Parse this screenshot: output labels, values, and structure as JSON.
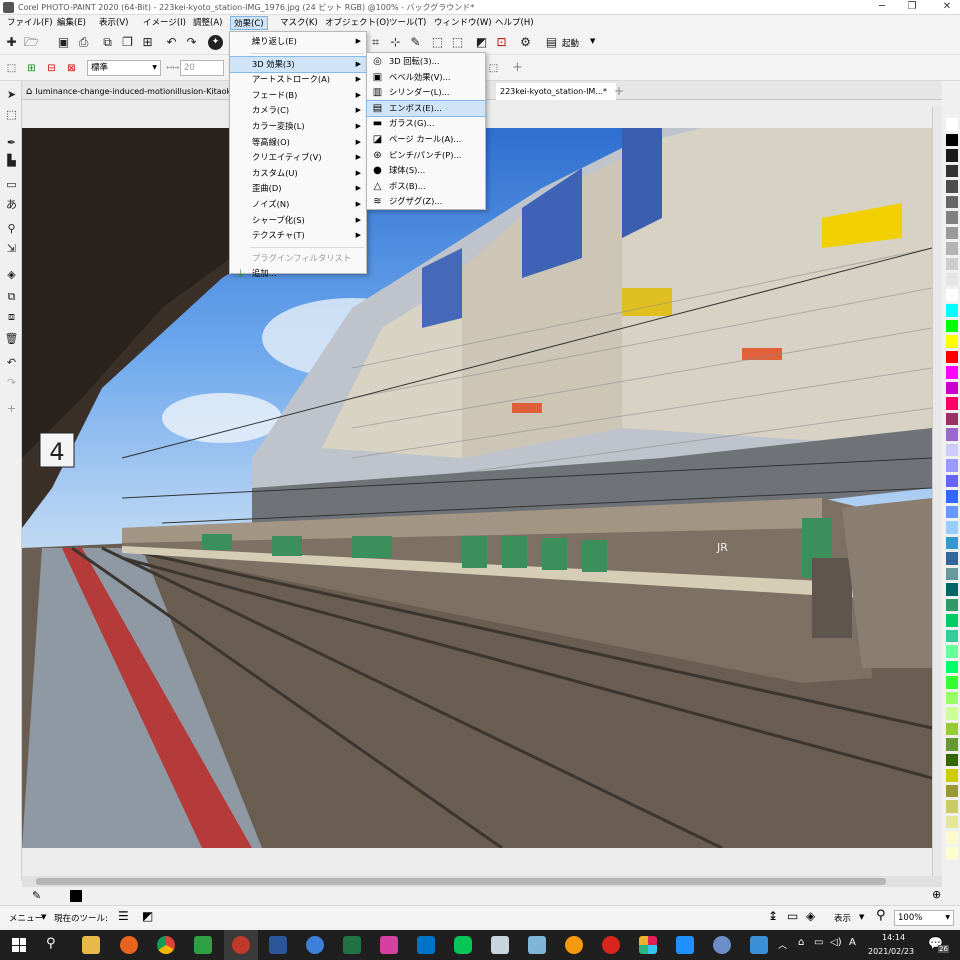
{
  "window": {
    "title": "Corel PHOTO-PAINT 2020 (64-Bit) - 223kei-kyoto_station-IMG_1976.jpg (24 ビット RGB) @100% - バックグラウンド*",
    "minimize": "─",
    "restore": "❐",
    "close": "✕"
  },
  "menubar": [
    "ファイル(F)",
    "編集(E)",
    "表示(V)",
    "イメージ(I)",
    "調整(A)",
    "効果(C)",
    "マスク(K)",
    "オブジェクト(O)",
    "ツール(T)",
    "ウィンドウ(W)",
    "ヘルプ(H)"
  ],
  "toolbar": {
    "launch_label": "起動",
    "mode_value": "標準",
    "size_value": "20"
  },
  "tabs": [
    "luminance-change-induced-motionillusion-Kitaoka200",
    "223kei-kyoto_station-IM...*"
  ],
  "effects_menu": {
    "items": [
      "繰り返し(E)",
      "3D 効果(3)",
      "アートストローク(A)",
      "フェード(B)",
      "カメラ(C)",
      "カラー変換(L)",
      "等高線(O)",
      "クリエイティブ(V)",
      "カスタム(U)",
      "歪曲(D)",
      "ノイズ(N)",
      "シャープ化(S)",
      "テクスチャ(T)"
    ],
    "plugin_list": "プラグインフィルタリスト",
    "add": "追加..."
  },
  "submenu_3d": {
    "items": [
      "3D 回転(3)...",
      "ベベル効果(V)...",
      "シリンダー(L)...",
      "エンボス(E)...",
      "ガラス(G)...",
      "ページ カール(A)...",
      "ピンチ/パンチ(P)...",
      "球体(S)...",
      "ボス(B)...",
      "ジグザグ(Z)..."
    ],
    "icons": [
      "rotate-3d-icon",
      "bevel-icon",
      "cylinder-icon",
      "emboss-icon",
      "glass-icon",
      "page-curl-icon",
      "pinch-punch-icon",
      "sphere-icon",
      "boss-icon",
      "zigzag-icon"
    ],
    "highlighted": "エンボス(E)..."
  },
  "canvas": {
    "platform_sign": "4",
    "train_logo": "JR"
  },
  "statusbar": {
    "menu_label": "メニュー",
    "current_tool_label": "現在のツール:",
    "view_label": "表示",
    "zoom_value": "100%"
  },
  "taskbar": {
    "time": "14:14",
    "date": "2021/02/23",
    "notification_count": "26",
    "ime": "A"
  },
  "palette_colors": [
    "#ffffff",
    "#000000",
    "#1a1a1a",
    "#333333",
    "#4d4d4d",
    "#666666",
    "#808080",
    "#999999",
    "#b3b3b3",
    "#cccccc",
    "#e6e6e6",
    "#ffffff",
    "#00ffff",
    "#00ff00",
    "#ffff00",
    "#ff0000",
    "#ff00ff",
    "#cc00cc",
    "#ff0066",
    "#993366",
    "#9966cc",
    "#ccccff",
    "#9999ff",
    "#6666ff",
    "#3366ff",
    "#6699ff",
    "#99ccff",
    "#3399cc",
    "#336699",
    "#669999",
    "#006666",
    "#339966",
    "#00cc66",
    "#33cc99",
    "#66ff99",
    "#00ff66",
    "#33ff33",
    "#99ff66",
    "#ccff99",
    "#99cc33",
    "#669933",
    "#336600",
    "#cccc00",
    "#999933",
    "#cccc66",
    "#e6e699",
    "#fffacd",
    "#ffffcc"
  ]
}
